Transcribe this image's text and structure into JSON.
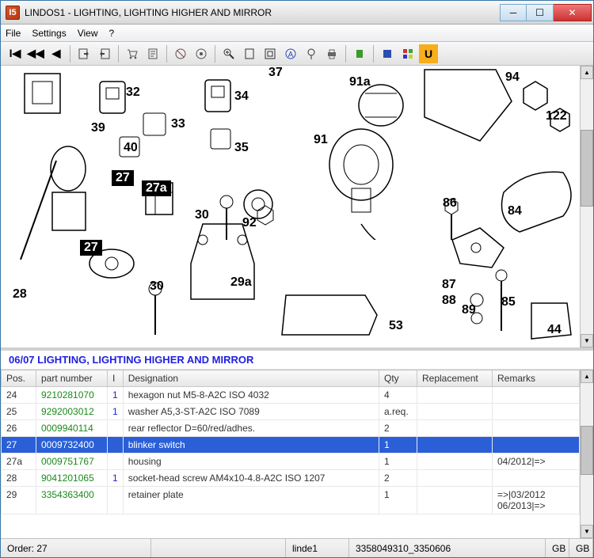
{
  "window": {
    "title": "LINDOS1 - LIGHTING, LIGHTING HIGHER AND MIRROR"
  },
  "menu": {
    "file": "File",
    "settings": "Settings",
    "view": "View",
    "help": "?"
  },
  "callouts": {
    "c27a": "27",
    "c27b": "27a",
    "c27c": "27",
    "c28": "28",
    "c29a": "29a",
    "c30a": "30",
    "c30b": "30",
    "c32": "32",
    "c33": "33",
    "c34": "34",
    "c35": "35",
    "c37": "37",
    "c39": "39",
    "c40": "40",
    "c44": "44",
    "c53": "53",
    "c84": "84",
    "c85": "85",
    "c86": "86",
    "c87": "87",
    "c88": "88",
    "c89": "89",
    "c91": "91",
    "c91a": "91a",
    "c92": "92",
    "c94": "94",
    "c122": "122"
  },
  "section": {
    "header": "06/07   LIGHTING, LIGHTING HIGHER AND MIRROR"
  },
  "table": {
    "cols": {
      "pos": "Pos.",
      "pn": "part number",
      "i": "I",
      "des": "Designation",
      "qty": "Qty",
      "rep": "Replacement",
      "rem": "Remarks"
    },
    "rows": [
      {
        "pos": "24",
        "pn": "9210281070",
        "i": "1",
        "des": "hexagon nut M5-8-A2C  ISO 4032",
        "qty": "4",
        "rep": "",
        "rem": ""
      },
      {
        "pos": "25",
        "pn": "9292003012",
        "i": "1",
        "des": "washer A5,3-ST-A2C  ISO 7089",
        "qty": "a.req.",
        "rep": "",
        "rem": ""
      },
      {
        "pos": "26",
        "pn": "0009940114",
        "i": "",
        "des": "rear reflector D=60/red/adhes.",
        "qty": "2",
        "rep": "",
        "rem": ""
      },
      {
        "pos": "27",
        "pn": "0009732400",
        "i": "",
        "des": "blinker switch",
        "qty": "1",
        "rep": "",
        "rem": "",
        "sel": true
      },
      {
        "pos": "27a",
        "pn": "0009751767",
        "i": "",
        "des": "housing",
        "qty": "1",
        "rep": "",
        "rem": "04/2012|=>"
      },
      {
        "pos": "28",
        "pn": "9041201065",
        "i": "1",
        "des": "socket-head screw AM4x10-4.8-A2C  ISO 1207",
        "qty": "2",
        "rep": "",
        "rem": ""
      },
      {
        "pos": "29",
        "pn": "3354363400",
        "i": "",
        "des": "retainer plate",
        "qty": "1",
        "rep": "",
        "rem": "=>|03/2012\n06/2013|=>"
      }
    ]
  },
  "status": {
    "order": "Order: 27",
    "user": "linde1",
    "doc": "3358049310_3350606",
    "gb1": "GB",
    "gb2": "GB"
  }
}
